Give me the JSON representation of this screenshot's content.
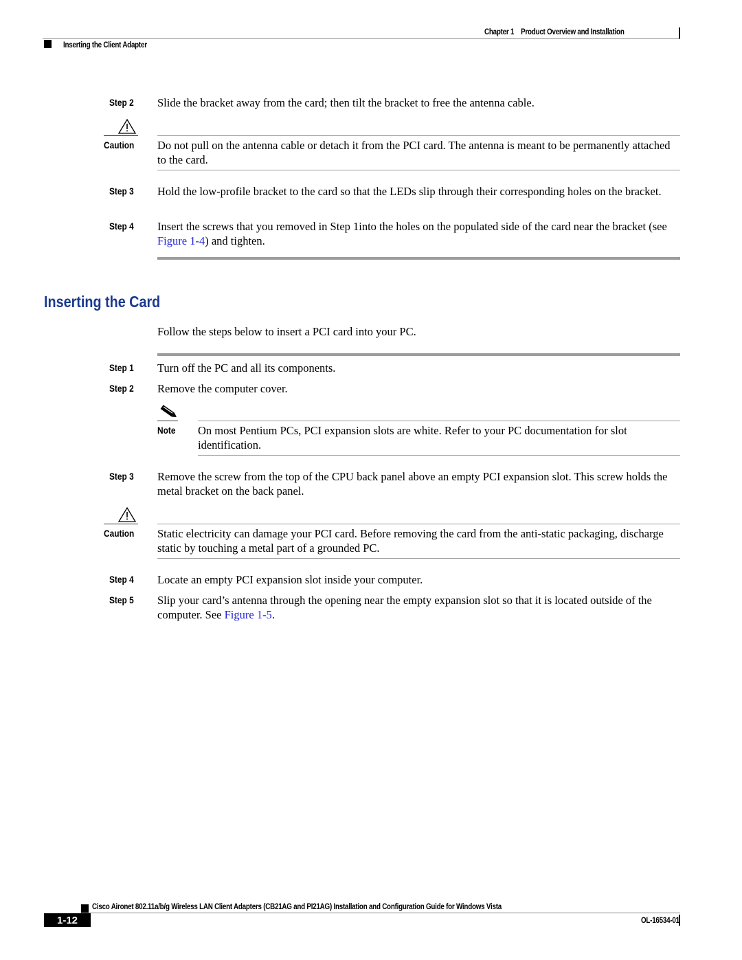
{
  "header": {
    "chapter": "Chapter 1",
    "chapter_title": "Product Overview and Installation",
    "section": "Inserting the Client Adapter"
  },
  "top_block": {
    "step2": {
      "label": "Step 2",
      "text": "Slide the bracket away from the card; then tilt the bracket to free the antenna cable."
    },
    "caution": {
      "label": "Caution",
      "icon": "warning-triangle-icon",
      "text": "Do not pull on the antenna cable or detach it from the PCI card. The antenna is meant to be permanently attached to the card."
    },
    "step3": {
      "label": "Step 3",
      "text": "Hold the low-profile bracket to the card so that the LEDs slip through their corresponding holes on the bracket."
    },
    "step4": {
      "label": "Step 4",
      "text_before": "Insert the screws that you removed in Step 1into the holes on the populated side of the card near the bracket (see ",
      "link": "Figure 1-4",
      "text_after": ") and tighten."
    }
  },
  "section": {
    "title": "Inserting the Card",
    "intro": "Follow the steps below to insert a PCI card into your PC.",
    "step1": {
      "label": "Step 1",
      "text": "Turn off the PC and all its components."
    },
    "step2": {
      "label": "Step 2",
      "text": "Remove the computer cover."
    },
    "note": {
      "label": "Note",
      "icon": "pencil-note-icon",
      "text": "On most Pentium PCs, PCI expansion slots are white. Refer to your PC documentation for slot identification."
    },
    "step3": {
      "label": "Step 3",
      "text": "Remove the screw from the top of the CPU back panel above an empty PCI expansion slot. This screw holds the metal bracket on the back panel."
    },
    "caution": {
      "label": "Caution",
      "icon": "warning-triangle-icon",
      "text": "Static electricity can damage your PCI card. Before removing the card from the anti-static packaging, discharge static by touching a metal part of a grounded PC."
    },
    "step4": {
      "label": "Step 4",
      "text": "Locate an empty PCI expansion slot inside your computer."
    },
    "step5": {
      "label": "Step 5",
      "text_before": "Slip your card’s antenna through the opening near the empty expansion slot so that it is located outside of the computer. See ",
      "link": "Figure 1-5",
      "text_after": "."
    }
  },
  "footer": {
    "guide_title": "Cisco Aironet 802.11a/b/g Wireless LAN Client Adapters (CB21AG and PI21AG) Installation and Configuration Guide for Windows Vista",
    "page_number": "1-12",
    "doc_number": "OL-16534-01"
  },
  "colors": {
    "heading": "#1b3a8f",
    "link": "#2323d6",
    "rule": "#9a9a9a"
  }
}
